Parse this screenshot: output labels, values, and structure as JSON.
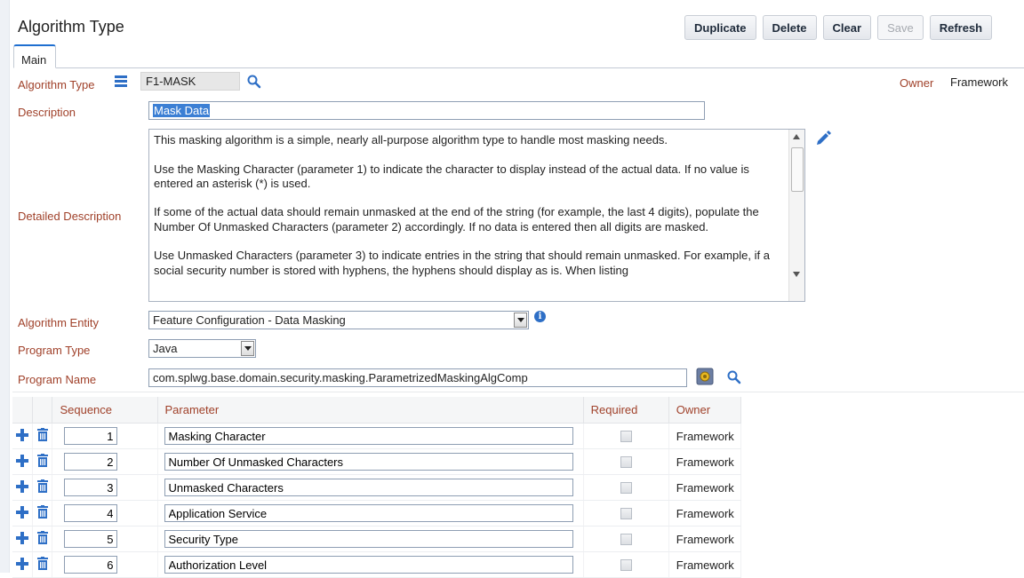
{
  "page": {
    "title": "Algorithm Type"
  },
  "toolbar": {
    "duplicate": "Duplicate",
    "delete": "Delete",
    "clear": "Clear",
    "save": "Save",
    "refresh": "Refresh"
  },
  "tabs": [
    {
      "label": "Main",
      "active": true
    }
  ],
  "form": {
    "algorithm_type_label": "Algorithm Type",
    "algorithm_type_value": "F1-MASK",
    "owner_label": "Owner",
    "owner_value": "Framework",
    "description_label": "Description",
    "description_value": "Mask Data",
    "detailed_description_label": "Detailed Description",
    "detailed_description_paragraphs": [
      "This masking algorithm is a simple, nearly all-purpose algorithm type to handle most masking needs.",
      "Use the Masking Character (parameter 1) to indicate the character to display instead of the actual data.  If no value is entered an asterisk (*) is used.",
      "If some of the actual data should remain unmasked at the end of the string (for example, the last 4 digits), populate the Number Of Unmasked Characters (parameter 2) accordingly.  If no data is entered then all digits are masked.",
      "Use Unmasked Characters (parameter 3) to indicate entries in the string that should remain unmasked.  For example, if a social security number is stored with hyphens, the hyphens should display as is.  When listing"
    ],
    "algorithm_entity_label": "Algorithm Entity",
    "algorithm_entity_value": "Feature Configuration - Data Masking",
    "program_type_label": "Program Type",
    "program_type_value": "Java",
    "program_name_label": "Program Name",
    "program_name_value": "com.splwg.base.domain.security.masking.ParametrizedMaskingAlgComp"
  },
  "params_grid": {
    "columns": [
      "Sequence",
      "Parameter",
      "Required",
      "Owner"
    ],
    "rows": [
      {
        "sequence": "1",
        "parameter": "Masking Character",
        "required": false,
        "owner": "Framework"
      },
      {
        "sequence": "2",
        "parameter": "Number Of Unmasked Characters",
        "required": false,
        "owner": "Framework"
      },
      {
        "sequence": "3",
        "parameter": "Unmasked Characters",
        "required": false,
        "owner": "Framework"
      },
      {
        "sequence": "4",
        "parameter": "Application Service",
        "required": false,
        "owner": "Framework"
      },
      {
        "sequence": "5",
        "parameter": "Security Type",
        "required": false,
        "owner": "Framework"
      },
      {
        "sequence": "6",
        "parameter": "Authorization Level",
        "required": false,
        "owner": "Framework"
      }
    ]
  },
  "colors": {
    "label": "#a0412a",
    "accent": "#1f6fd0",
    "icon_blue": "#2e6fc6"
  },
  "icons": [
    "menu-icon",
    "search-icon",
    "edit-pencil-icon",
    "info-icon",
    "program-source-icon",
    "add-row-icon",
    "delete-row-icon"
  ]
}
